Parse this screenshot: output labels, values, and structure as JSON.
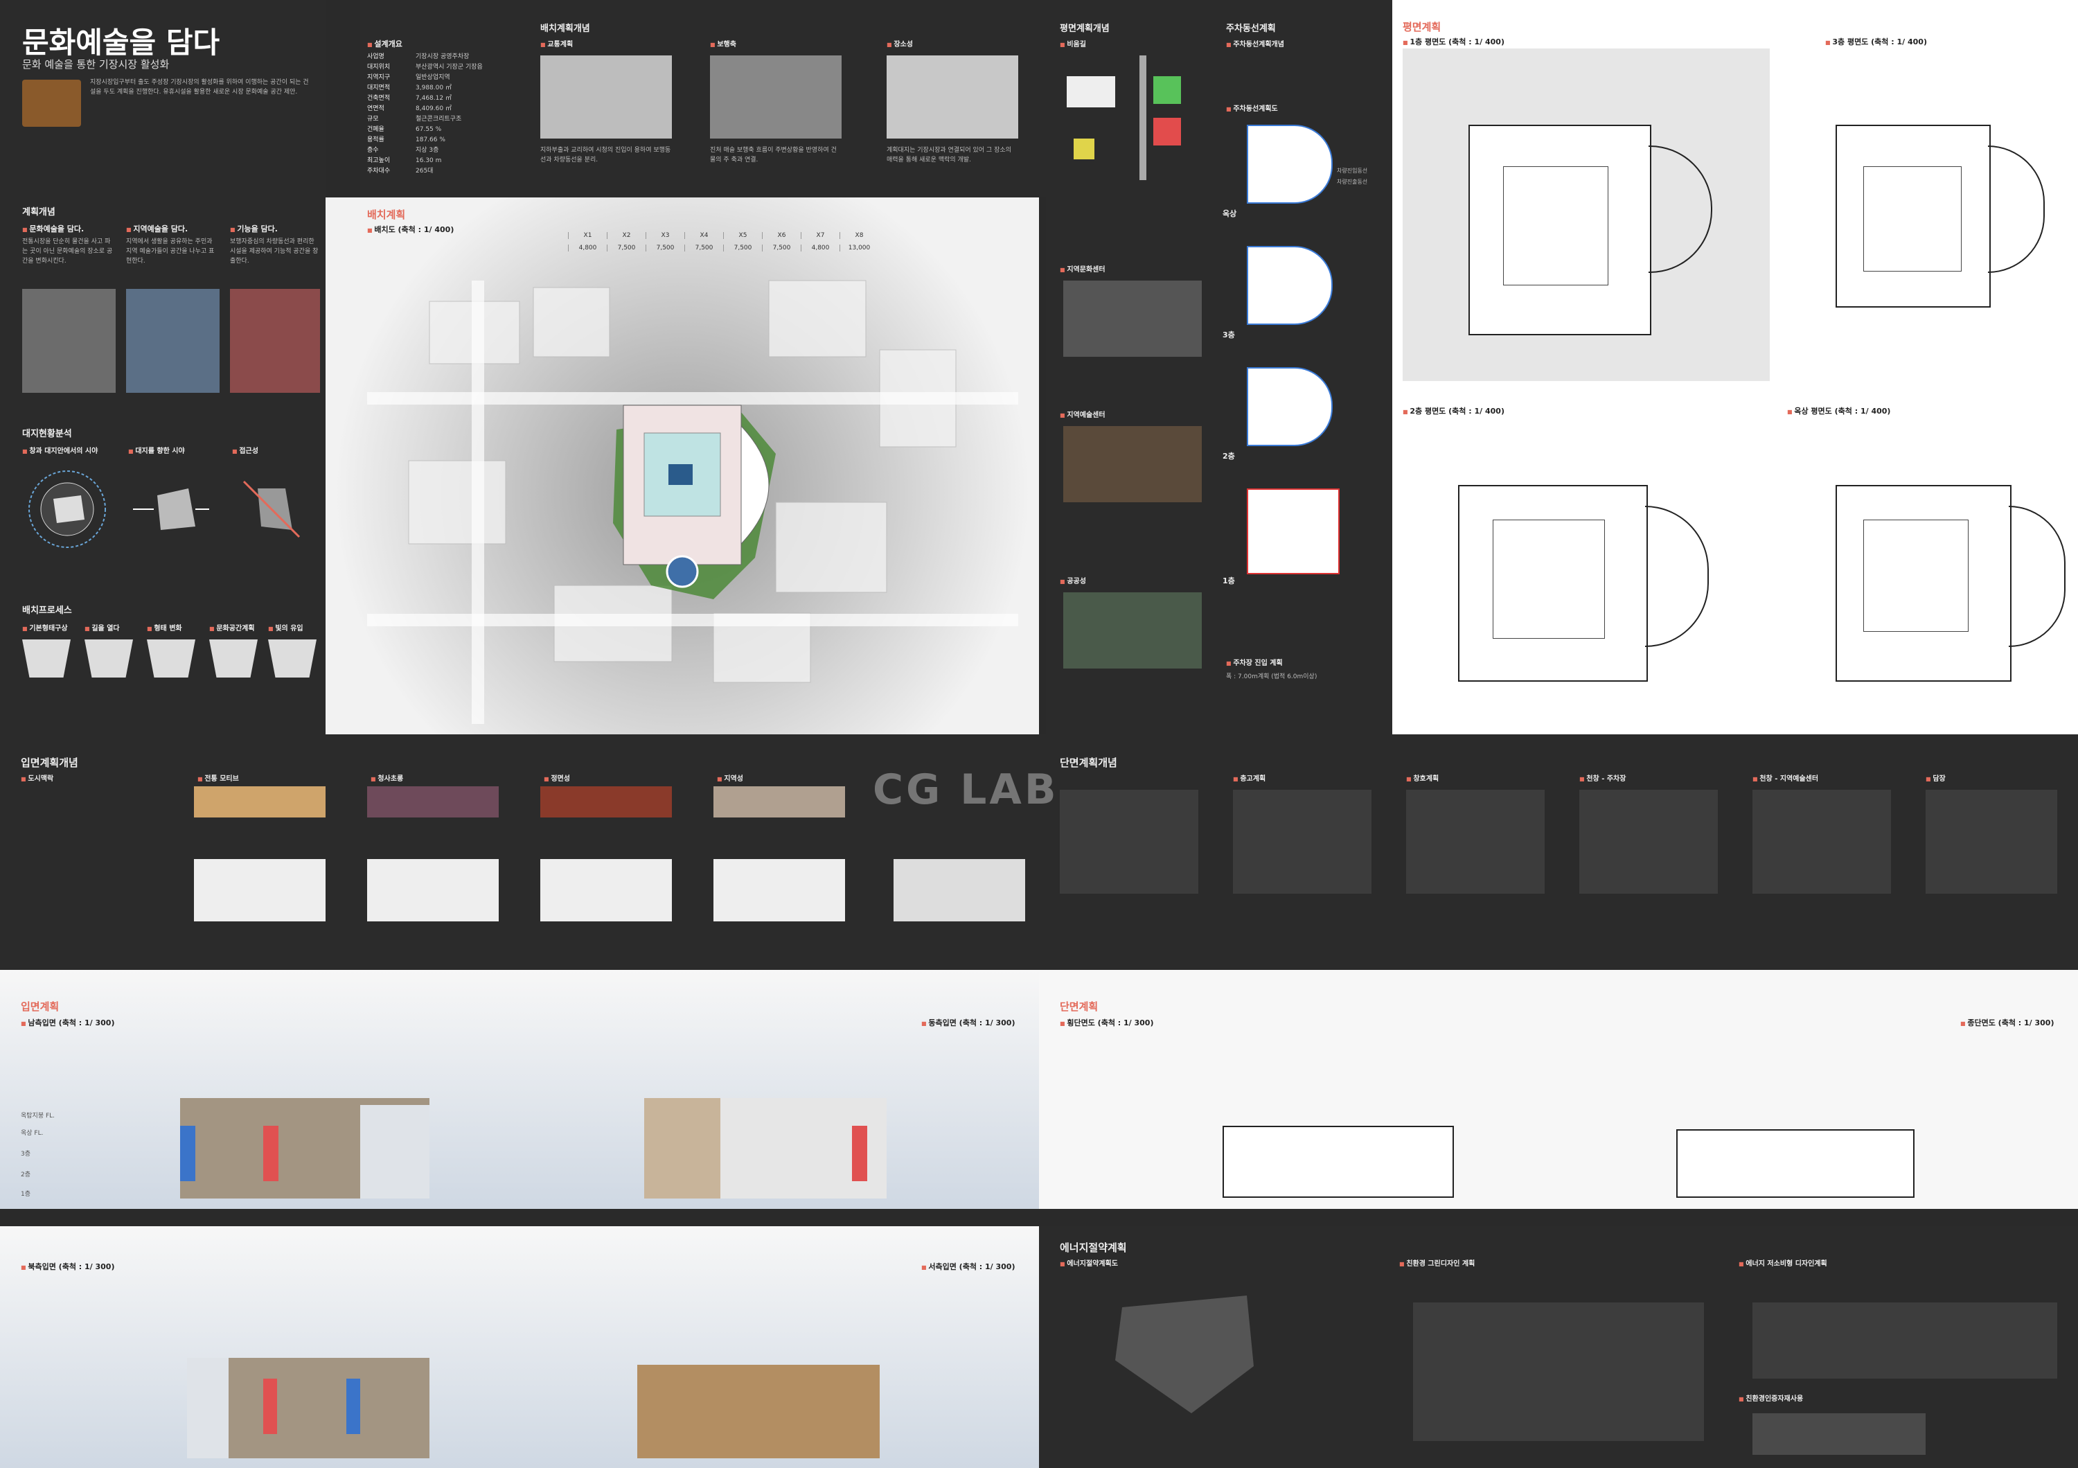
{
  "header": {
    "title": "문화예술을 담다",
    "subtitle": "문화 예술을 통한 기장시장 활성화"
  },
  "intro": {
    "paragraph": "지장시장입구부터 출도 주성장 기장시장의 활성화를 위하여 이행하는 공간이 되는 건설을 두도 계획을 진행한다. 유휴시설을 활용한 새로운 시장 문화예술 공간 제안."
  },
  "overview": {
    "title": "설계개요",
    "rows": [
      {
        "k": "사업명",
        "v": "기장시장 공영주차장"
      },
      {
        "k": "대지위치",
        "v": "부산광역시 기장군 기장읍"
      },
      {
        "k": "지역지구",
        "v": "일반상업지역"
      },
      {
        "k": "대지면적",
        "v": "3,988.00 ㎡"
      },
      {
        "k": "건축면적",
        "v": "7,468.12 ㎡"
      },
      {
        "k": "연면적",
        "v": "8,409.60 ㎡"
      },
      {
        "k": "규모",
        "v": "철근콘크리트구조"
      },
      {
        "k": "건폐율",
        "v": "67.55 %"
      },
      {
        "k": "용적률",
        "v": "187.66 %"
      },
      {
        "k": "층수",
        "v": "지상 3층"
      },
      {
        "k": "최고높이",
        "v": "16.30 m"
      },
      {
        "k": "주차대수",
        "v": "265대"
      }
    ]
  },
  "siteConcept": {
    "title": "배치계획개념",
    "items": [
      {
        "label": "교통계획",
        "text": "지하부출과 교리하여 시청의 진입이 용하여 보행동선과 차량동선을 분리."
      },
      {
        "label": "보행축",
        "text": "진처 매슬 보행축 흐름이 주변상황을 반영하여 건물의 주 축과 연결."
      },
      {
        "label": "장소성",
        "text": "계획대지는 기장시장과 연결되어 있어 그 장소의 매력을 통해 새로운 맥락의 개발."
      }
    ]
  },
  "parking": {
    "title": "평면계획개념",
    "sub": "비움길"
  },
  "parkingFlow": {
    "title": "주차동선계획",
    "sub1": "주차동선계획개념",
    "sub2": "주차동선계획도",
    "floors": [
      "옥상",
      "3층",
      "2층",
      "1층"
    ],
    "legend": [
      "차량진입동선",
      "차량진출동선"
    ]
  },
  "planning": {
    "title": "계획개념",
    "items": [
      {
        "label": "문화예술을 담다.",
        "text": "전통시장을 단순히 물건을 사고 파는 곳이 아닌 문화예술의 장소로 공간을 변화시킨다."
      },
      {
        "label": "지역예술을 담다.",
        "text": "지역에서 생활을 공유하는 주민과 지역 예술가들이 공간을 나누고 표현한다."
      },
      {
        "label": "기능을 담다.",
        "text": "보행자중심의 차량동선과 편리한 시설을 제공하여 기능적 공간을 창출한다."
      }
    ]
  },
  "siteAnalysis": {
    "title": "대지현황분석",
    "items": [
      "창과 대지안에서의 시야",
      "대지를 향한 시야",
      "접근성"
    ]
  },
  "process": {
    "title": "배치프로세스",
    "steps": [
      "기본형태구상",
      "길을 열다",
      "형태 변화",
      "문화공간계획",
      "빛의 유입"
    ]
  },
  "sitePlan": {
    "title": "배치계획",
    "scale": "배치도 (축척 : 1/ 400)",
    "dims": [
      "X1",
      "X2",
      "X3",
      "X4",
      "X5",
      "X6",
      "X7",
      "X8"
    ],
    "dimVals": [
      "4,800",
      "7,500",
      "7,500",
      "7,500",
      "7,500",
      "7,500",
      "4,800",
      "13,000"
    ]
  },
  "floorPlans": {
    "title": "평면계획",
    "plans": [
      {
        "name": "1층 평면도",
        "scale": "(축척 : 1/ 400)"
      },
      {
        "name": "3층 평면도",
        "scale": "(축척 : 1/ 400)"
      },
      {
        "name": "2층 평면도",
        "scale": "(축척 : 1/ 400)"
      },
      {
        "name": "옥상 평면도",
        "scale": "(축척 : 1/ 400)"
      }
    ]
  },
  "programs": {
    "items": [
      {
        "label": "지역문화센터"
      },
      {
        "label": "지역예술센터"
      },
      {
        "label": "공공성"
      }
    ],
    "turnTitle": "주차장 진입 계획",
    "turnNote": "폭 : 7.00m계획 (법적 6.0m이상)"
  },
  "facade": {
    "title": "입면계획개념",
    "items": [
      "도시맥락",
      "전통 모티브",
      "청사초롱",
      "정면성",
      "지역성"
    ]
  },
  "sectionConcept": {
    "title": "단면계획개념",
    "items": [
      "층고계획",
      "창호계획",
      "천창 - 주차장",
      "천창 - 지역예술센터",
      "담장"
    ]
  },
  "elevations": {
    "title": "입면계획",
    "items": [
      {
        "name": "남측입면",
        "scale": "(축척 : 1/ 300)"
      },
      {
        "name": "동측입면",
        "scale": "(축척 : 1/ 300)"
      },
      {
        "name": "북측입면",
        "scale": "(축척 : 1/ 300)"
      },
      {
        "name": "서측입면",
        "scale": "(축척 : 1/ 300)"
      }
    ],
    "levels": [
      "옥탑지붕 FL.",
      "옥상 FL.",
      "3층",
      "2층",
      "1층"
    ]
  },
  "sections": {
    "title": "단면계획",
    "items": [
      {
        "name": "횡단면도",
        "scale": "(축척 : 1/ 300)"
      },
      {
        "name": "종단면도",
        "scale": "(축척 : 1/ 300)"
      }
    ]
  },
  "energy": {
    "title": "에너지절약계획",
    "sub1": "에너지절약계획도",
    "sub2": "친환경 그린디자인 계획",
    "sub3": "에너지 저소비형 디자인계획",
    "sub4": "친환경인증자재사용"
  },
  "watermark": "CG LAB"
}
